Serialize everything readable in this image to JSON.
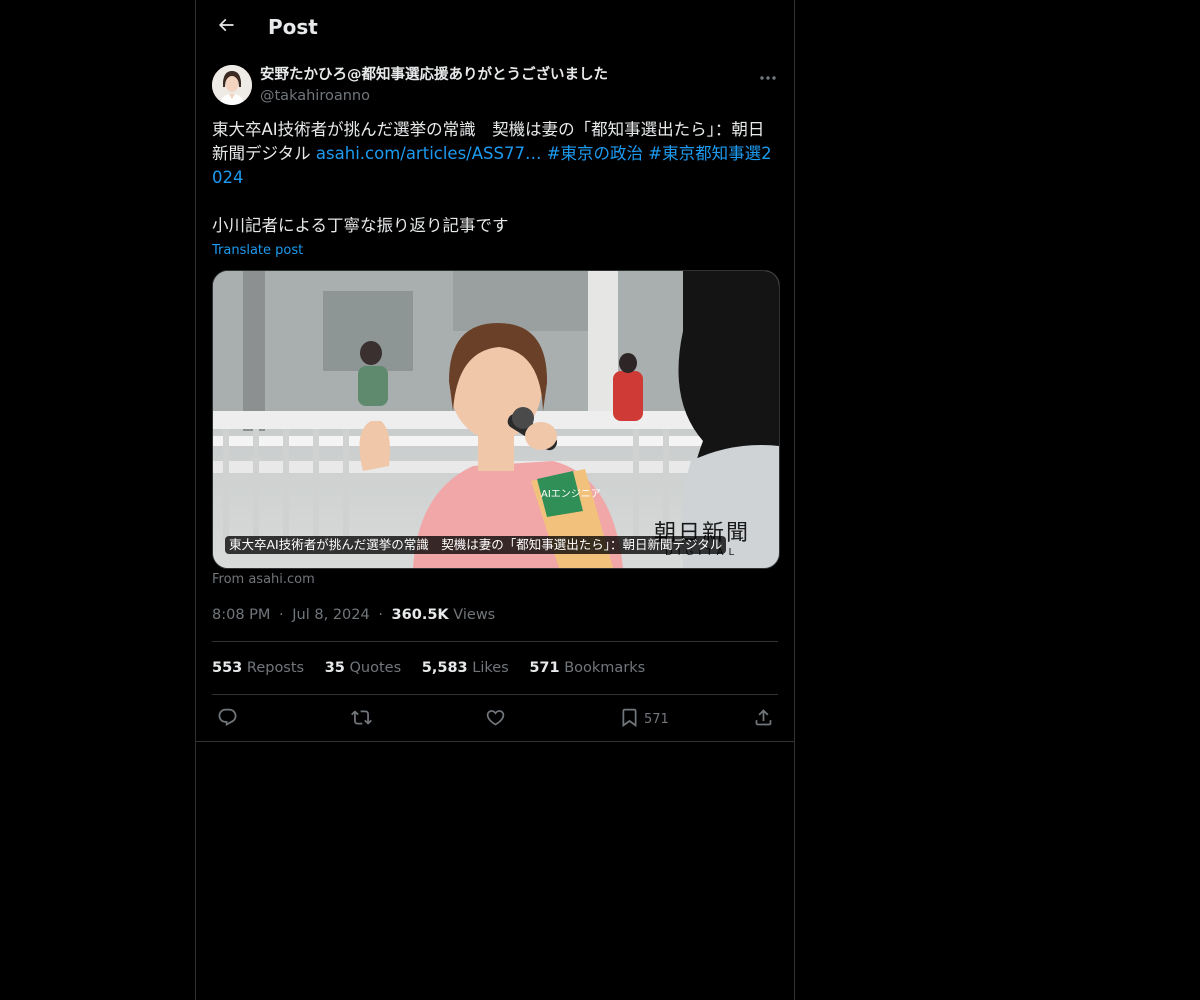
{
  "header": {
    "title": "Post"
  },
  "author": {
    "name": "安野たかひろ@都知事選応援ありがとうございました",
    "handle": "@takahiroanno"
  },
  "post": {
    "text_line1": "東大卒AI技術者が挑んだ選挙の常識　契機は妻の「都知事選出たら」：朝日新聞デジタル ",
    "link": "asahi.com/articles/ASS77…",
    "hashtag1": "#東京の政治",
    "hashtag2": "#東京都知事選2024",
    "text_line2": "小川記者による丁寧な振り返り記事です",
    "translate_label": "Translate post"
  },
  "card": {
    "caption": "東大卒AI技術者が挑んだ選挙の常識　契機は妻の「都知事選出たら」：朝日新聞デジタル",
    "logo_main": "朝日新聞",
    "logo_sub": "DIGITAL",
    "sash_text": "AIエンジニア",
    "from": "From asahi.com"
  },
  "meta": {
    "time": "8:08 PM",
    "date": "Jul 8, 2024",
    "views_count": "360.5K",
    "views_label": "Views",
    "separator": "·"
  },
  "stats": {
    "reposts_count": "553",
    "reposts_label": "Reposts",
    "quotes_count": "35",
    "quotes_label": "Quotes",
    "likes_count": "5,583",
    "likes_label": "Likes",
    "bookmarks_count": "571",
    "bookmarks_label": "Bookmarks"
  },
  "actions": {
    "bookmark_count": "571"
  },
  "colors": {
    "background": "#000000",
    "text": "#e7e9ea",
    "secondary": "#71767b",
    "accent": "#1d9bf0",
    "border": "#2f3336"
  },
  "icons": [
    "back-arrow-icon",
    "more-icon",
    "reply-icon",
    "repost-icon",
    "like-icon",
    "bookmark-icon",
    "share-icon"
  ]
}
